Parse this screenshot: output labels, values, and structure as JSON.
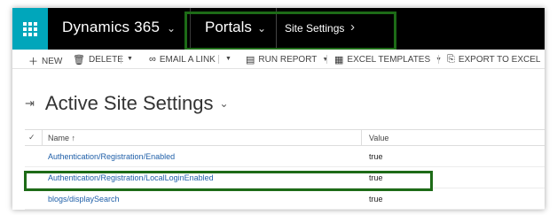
{
  "nav": {
    "app_name": "Dynamics 365",
    "area": "Portals",
    "entity": "Site Settings"
  },
  "commands": [
    {
      "label": "NEW"
    },
    {
      "label": "DELETE"
    },
    {
      "label": "EMAIL A LINK"
    },
    {
      "label": "RUN REPORT"
    },
    {
      "label": "EXCEL TEMPLATES"
    },
    {
      "label": "EXPORT TO EXCEL"
    }
  ],
  "view": {
    "title": "Active Site Settings"
  },
  "grid": {
    "columns": {
      "name": "Name ↑",
      "value": "Value"
    },
    "rows": [
      {
        "name": "Authentication/Registration/Enabled",
        "value": "true"
      },
      {
        "name": "Authentication/Registration/LocalLoginEnabled",
        "value": "true"
      },
      {
        "name": "blogs/displaySearch",
        "value": "true"
      }
    ]
  },
  "colors": {
    "waffle": "#00a6bb",
    "navbar": "#000000",
    "highlight": "#1d6b17",
    "link": "#1f5fa8"
  }
}
